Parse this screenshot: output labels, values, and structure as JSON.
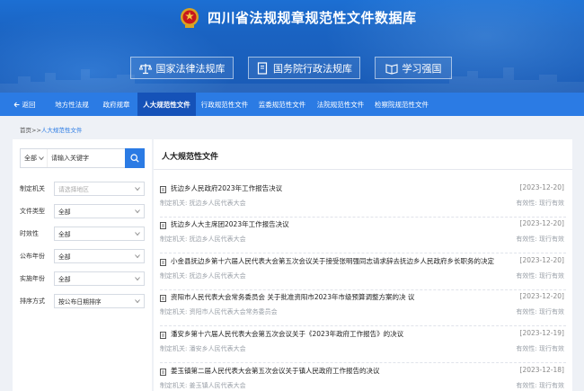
{
  "site": {
    "title": "四川省法规规章规范性文件数据库"
  },
  "quick_links": [
    {
      "label": "国家法律法规库",
      "icon": "scales-icon"
    },
    {
      "label": "国务院行政法规库",
      "icon": "document-icon"
    },
    {
      "label": "学习强国",
      "icon": "book-icon"
    }
  ],
  "nav": {
    "back_label": "返回",
    "items": [
      {
        "label": "地方性法规",
        "active": false
      },
      {
        "label": "政府规章",
        "active": false
      },
      {
        "label": "人大规范性文件",
        "active": true
      },
      {
        "label": "行政规范性文件",
        "active": false
      },
      {
        "label": "监委规范性文件",
        "active": false
      },
      {
        "label": "法院规范性文件",
        "active": false
      },
      {
        "label": "检察院规范性文件",
        "active": false
      }
    ]
  },
  "breadcrumb": {
    "home": "首页",
    "sep": ">>",
    "current": "人大规范性文件"
  },
  "search": {
    "scope": "全部",
    "placeholder": "请输入关键字"
  },
  "filters": [
    {
      "label": "制定机关",
      "value": "请选择地区",
      "placeholder": true
    },
    {
      "label": "文件类型",
      "value": "全部",
      "placeholder": false
    },
    {
      "label": "时效性",
      "value": "全部",
      "placeholder": false
    },
    {
      "label": "公布年份",
      "value": "全部",
      "placeholder": false
    },
    {
      "label": "实施年份",
      "value": "全部",
      "placeholder": false
    },
    {
      "label": "排序方式",
      "value": "按公布日期排序",
      "placeholder": false
    }
  ],
  "main": {
    "title": "人大规范性文件",
    "documents": [
      {
        "title": "抚边乡人民政府2023年工作报告决议",
        "date": "[2023-12-20]",
        "org": "制定机关: 抚边乡人民代表大会",
        "status": "有效性: 现行有效"
      },
      {
        "title": "抚边乡人大主席团2023年工作报告决议",
        "date": "[2023-12-20]",
        "org": "制定机关: 抚边乡人民代表大会",
        "status": "有效性: 现行有效"
      },
      {
        "title": "小金县抚边乡第十六届人民代表大会第五次会议关于接受张明强同志请求辞去抚边乡人民政府乡长职务的决定",
        "date": "[2023-12-20]",
        "org": "制定机关: 抚边乡人民代表大会",
        "status": "有效性: 现行有效"
      },
      {
        "title": "资阳市人民代表大会常务委员会 关于批准资阳市2023年市级预算调整方案的决 议",
        "date": "[2023-12-20]",
        "org": "制定机关: 资阳市人民代表大会常务委员会",
        "status": "有效性: 现行有效"
      },
      {
        "title": "潘安乡第十六届人民代表大会第五次会议关于《2023年政府工作报告》的决议",
        "date": "[2023-12-19]",
        "org": "制定机关: 潘安乡人民代表大会",
        "status": "有效性: 现行有效"
      },
      {
        "title": "姜玉镇第二届人民代表大会第五次会议关于镇人民政府工作报告的决议",
        "date": "[2023-12-18]",
        "org": "制定机关: 姜玉镇人民代表大会",
        "status": "有效性: 现行有效"
      }
    ]
  }
}
